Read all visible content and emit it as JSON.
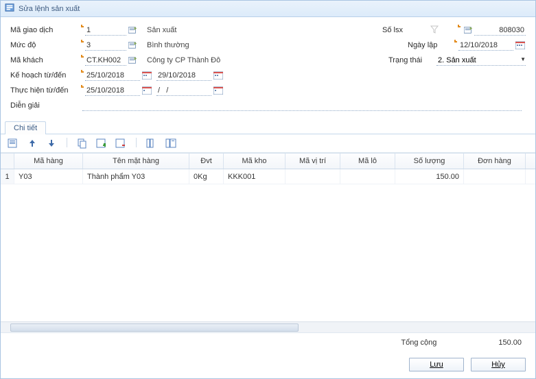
{
  "window": {
    "title": "Sửa lệnh sản xuất"
  },
  "form": {
    "labels": {
      "trans": "Mã giao dịch",
      "level": "Mức độ",
      "customer": "Mã khách",
      "plan": "Kế hoạch từ/đến",
      "exec": "Thực hiện từ/đến",
      "desc": "Diễn giải",
      "orderNo": "Số lsx",
      "issueDate": "Ngày lập",
      "status": "Trạng thái"
    },
    "trans": {
      "code": "1",
      "name": "Sản xuất"
    },
    "level": {
      "code": "3",
      "name": "Bình thường"
    },
    "customer": {
      "code": "CT.KH002",
      "name": "Công ty CP Thành Đô"
    },
    "plan": {
      "from": "25/10/2018",
      "to": "29/10/2018"
    },
    "exec": {
      "from": "25/10/2018",
      "to": "/   /"
    },
    "desc": "",
    "orderNo": "808030",
    "issueDate": "12/10/2018",
    "status": "2. Sản xuất"
  },
  "tabs": {
    "detail": "Chi tiết"
  },
  "grid": {
    "headers": {
      "code": "Mã hàng",
      "name": "Tên mặt hàng",
      "unit": "Đvt",
      "wh": "Mã kho",
      "loc": "Mã vị trí",
      "lot": "Mã lô",
      "qty": "Số lượng",
      "order": "Đơn hàng"
    },
    "rows": [
      {
        "idx": "1",
        "code": "Y03",
        "name": "Thành phẩm Y03",
        "unit": "0Kg",
        "wh": "KKK001",
        "loc": "",
        "lot": "",
        "qty": "150.00",
        "order": ""
      }
    ]
  },
  "totals": {
    "label": "Tổng cộng",
    "qty": "150.00"
  },
  "buttons": {
    "save": "Lưu",
    "cancel": "Hủy"
  }
}
